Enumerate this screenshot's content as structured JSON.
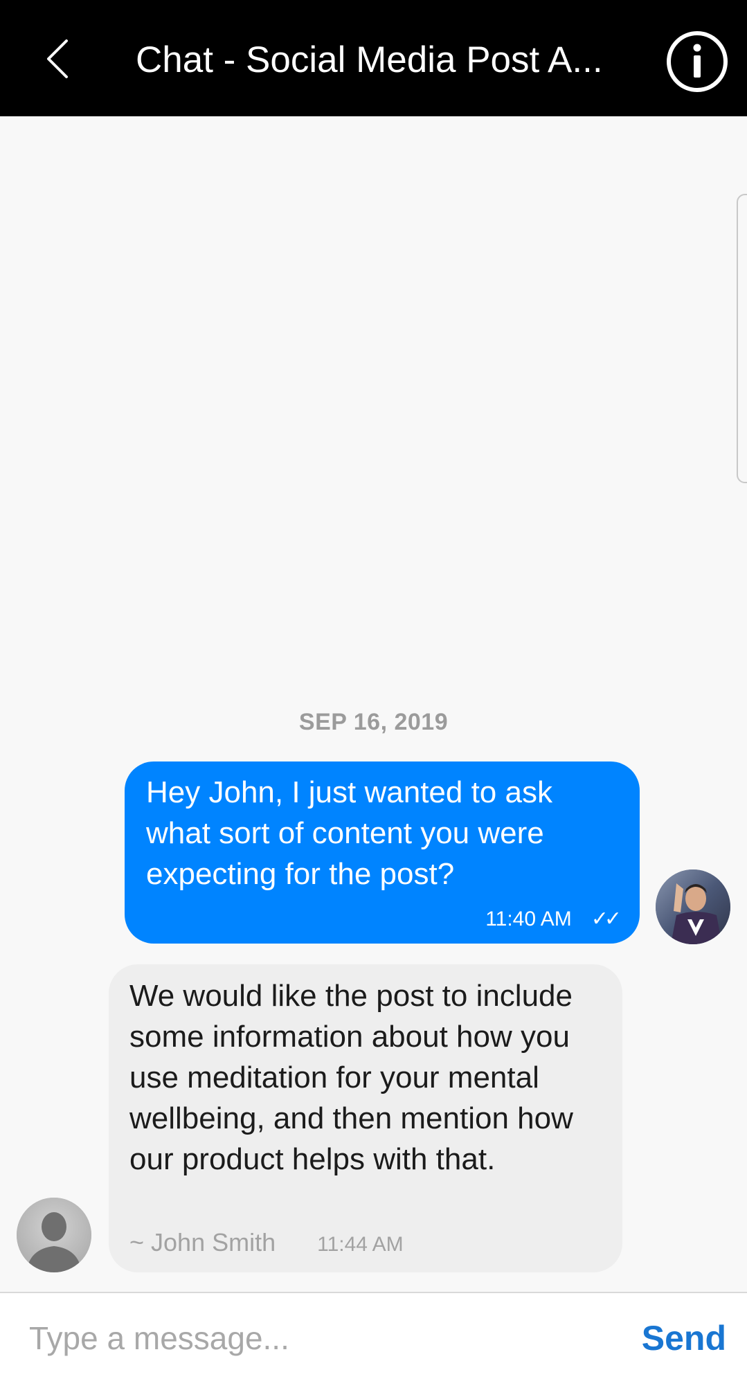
{
  "header": {
    "title": "Chat - Social Media Post A...",
    "back_icon": "chevron-left-icon",
    "info_icon": "info-circle-icon"
  },
  "conversation": {
    "date_divider": "SEP 16, 2019",
    "messages": [
      {
        "direction": "outgoing",
        "text": "Hey John, I just wanted to ask what sort of content you were expecting for the post?",
        "time": "11:40 AM",
        "status_icon": "double-check-icon",
        "status_glyph": "✓✓"
      },
      {
        "direction": "incoming",
        "text": "We would like the post to include some information about how you use meditation for your mental wellbeing, and then mention how our product helps with that.",
        "sender": "~ John Smith",
        "time": "11:44 AM"
      }
    ]
  },
  "composer": {
    "placeholder": "Type a message...",
    "value": "",
    "send_label": "Send"
  },
  "colors": {
    "header_bg": "#000000",
    "outgoing_bubble": "#0084ff",
    "incoming_bubble": "#eeeeee",
    "send_accent": "#1976d2",
    "background": "#f8f8f8"
  }
}
